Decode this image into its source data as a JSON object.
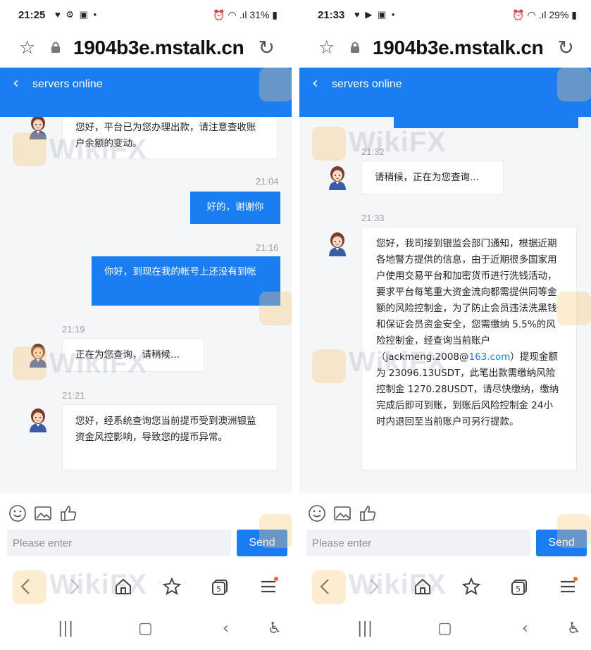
{
  "left": {
    "status": {
      "time": "21:25",
      "battery": "31%"
    },
    "url": "1904b3e.mstalk.cn",
    "header_title": "servers online",
    "messages": [
      {
        "text": "您好，平台已为您办理出款，请注意查收账户余额的变动。"
      },
      {
        "time": "21:04",
        "text": "好的，谢谢你"
      },
      {
        "time": "21:16",
        "text": "你好，到现在我的帐号上还没有到帐"
      },
      {
        "time": "21:19",
        "text": "正在为您查询，请稍候..."
      },
      {
        "time": "21:21",
        "text": "您好，经系统查询您当前提币受到澳洲银监资金风控影响，导致您的提币异常。"
      }
    ],
    "input_placeholder": "Please enter",
    "send_label": "Send"
  },
  "right": {
    "status": {
      "time": "21:33",
      "battery": "29%"
    },
    "url": "1904b3e.mstalk.cn",
    "header_title": "servers online",
    "messages": [
      {
        "time": "21:32",
        "text": "请稍候，正在为您查询..."
      },
      {
        "time": "21:33",
        "text_a": "您好，我司接到银监会部门通知，根据近期各地警方提供的信息，由于近期很多国家用户使用交易平台和加密货币进行洗钱活动，要求平台每笔重大资金流向都需提供同等金额的风险控制金，为了防止会员违法洗黑钱和保证会员资金安全，您需缴纳 5.5%的风险控制金，经查询当前账户",
        "email_user": "（jackmeng.2008@",
        "email_domain": "163.com",
        "text_b": "）提现金额为 23096.13USDT，此笔出款需缴纳风险控制金 1270.28USDT，请尽快缴纳，缴纳完成后即可到账，到账后风险控制金 24小时内退回至当前账户可另行提款。"
      }
    ],
    "input_placeholder": "Please enter",
    "send_label": "Send"
  },
  "watermark": "WikiFX",
  "colors": {
    "accent": "#1a7df2",
    "chat_bg": "#f5f6f8",
    "bubble_in": "#ffffff",
    "notification_dot": "#f06a2a"
  },
  "icons": [
    "star-icon",
    "lock-icon",
    "reload-icon",
    "back-icon",
    "emoji-icon",
    "image-icon",
    "thumbs-up-icon",
    "browser-back-icon",
    "browser-forward-icon",
    "home-icon",
    "bookmark-star-icon",
    "tabs-icon",
    "menu-icon",
    "recents-icon",
    "system-home-icon",
    "system-back-icon",
    "accessibility-icon"
  ]
}
